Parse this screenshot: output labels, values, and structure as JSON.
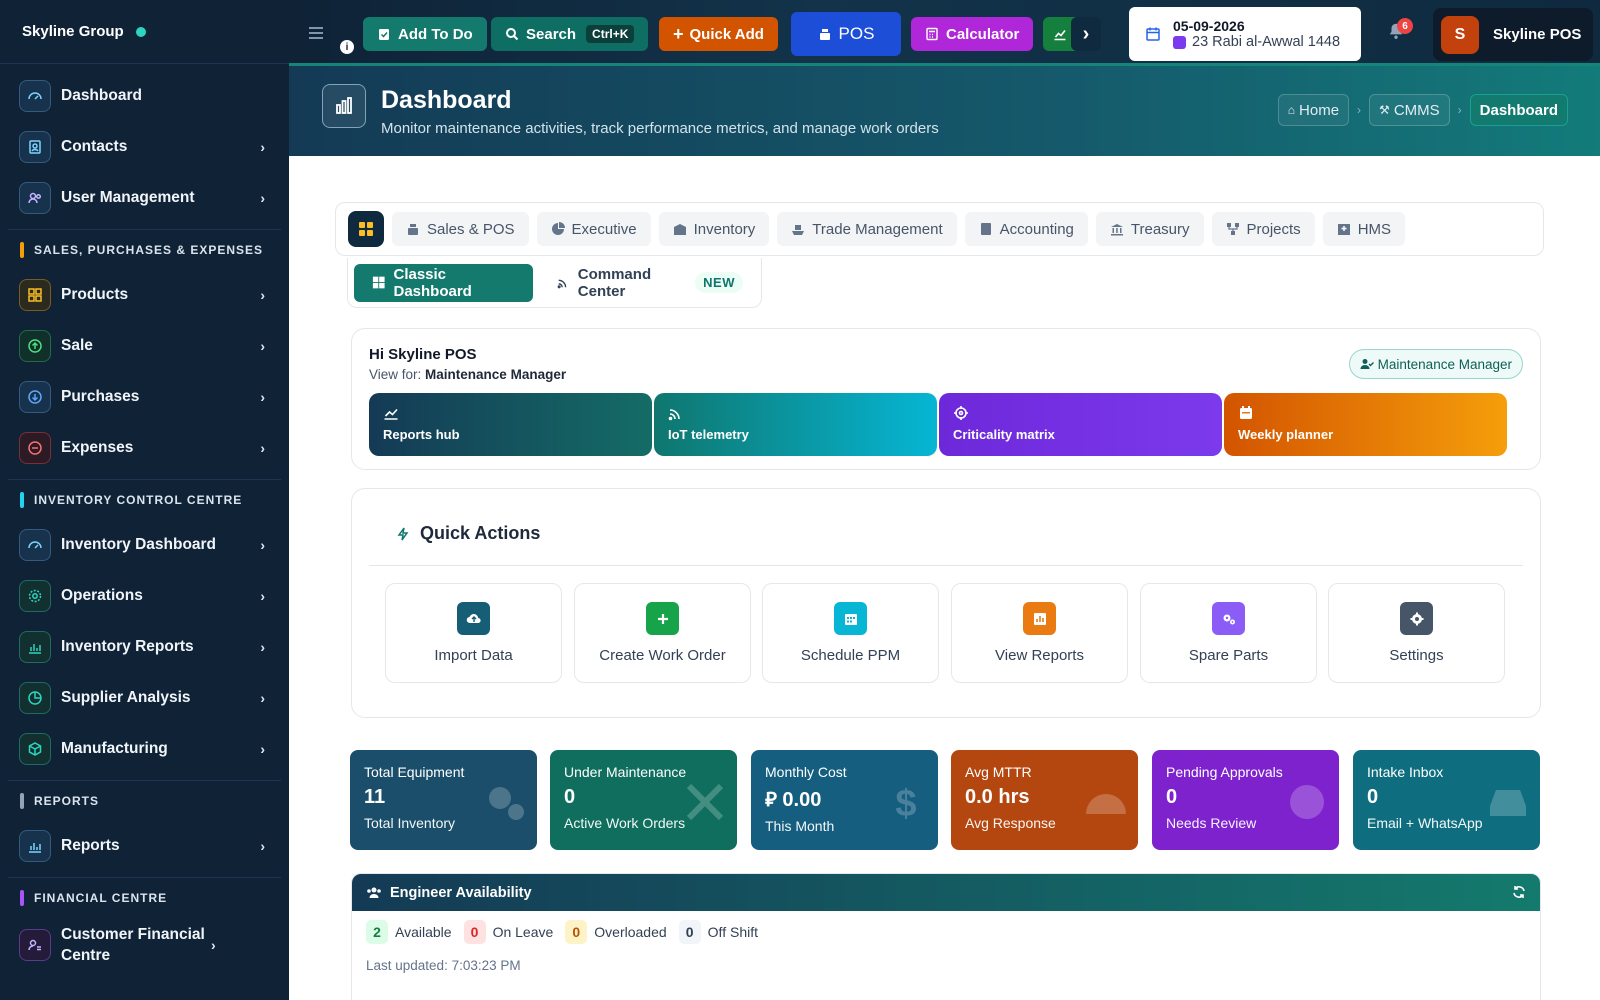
{
  "sidebar": {
    "brand": "Skyline Group",
    "top_items": [
      {
        "label": "Dashboard"
      },
      {
        "label": "Contacts"
      },
      {
        "label": "User Management"
      }
    ],
    "sections": [
      {
        "title": "SALES, PURCHASES & EXPENSES",
        "color": "#f59e0b",
        "items": [
          {
            "label": "Products"
          },
          {
            "label": "Sale"
          },
          {
            "label": "Purchases"
          },
          {
            "label": "Expenses"
          }
        ]
      },
      {
        "title": "INVENTORY CONTROL CENTRE",
        "color": "#22d3ee",
        "items": [
          {
            "label": "Inventory Dashboard"
          },
          {
            "label": "Operations"
          },
          {
            "label": "Inventory Reports"
          },
          {
            "label": "Supplier Analysis"
          },
          {
            "label": "Manufacturing"
          }
        ]
      },
      {
        "title": "REPORTS",
        "color": "#94a3b8",
        "items": [
          {
            "label": "Reports"
          }
        ]
      },
      {
        "title": "FINANCIAL CENTRE",
        "color": "#a855f7",
        "items": [
          {
            "label": "Customer Financial Centre"
          }
        ]
      }
    ]
  },
  "topbar": {
    "add_todo": "Add To Do",
    "search": "Search",
    "search_shortcut": "Ctrl+K",
    "quick_add": "Quick Add",
    "pos": "POS",
    "calculator": "Calculator",
    "date": "05-09-2026",
    "hijri_date": "23 Rabi al-Awwal 1448",
    "notification_count": "6",
    "avatar_initial": "S",
    "profile_name": "Skyline POS"
  },
  "header": {
    "title": "Dashboard",
    "subtitle": "Monitor maintenance activities, track performance metrics, and manage work orders",
    "breadcrumbs": [
      "Home",
      "CMMS",
      "Dashboard"
    ]
  },
  "module_tabs": [
    "Sales & POS",
    "Executive",
    "Inventory",
    "Trade Management",
    "Accounting",
    "Treasury",
    "Projects",
    "HMS"
  ],
  "view_tabs": {
    "classic": "Classic Dashboard",
    "command": "Command Center",
    "new_badge": "NEW"
  },
  "greeting": {
    "title": "Hi Skyline POS",
    "view_for_label": "View for:",
    "view_for_value": "Maintenance Manager",
    "role": "Maintenance Manager",
    "shortcuts": [
      "Reports hub",
      "IoT telemetry",
      "Criticality matrix",
      "Weekly planner"
    ]
  },
  "quick_actions": {
    "title": "Quick Actions",
    "items": [
      "Import Data",
      "Create Work Order",
      "Schedule PPM",
      "View Reports",
      "Spare Parts",
      "Settings"
    ]
  },
  "stats": [
    {
      "title": "Total Equipment",
      "value": "11",
      "sub": "Total Inventory",
      "color": "#155e75"
    },
    {
      "title": "Under Maintenance",
      "value": "0",
      "sub": "Active Work Orders",
      "color": "#0f766e"
    },
    {
      "title": "Monthly Cost",
      "value": "⃁ 0.00",
      "sub": "This Month",
      "color": "#0e5f7d"
    },
    {
      "title": "Avg MTTR",
      "value": "0.0 hrs",
      "sub": "Avg Response",
      "color": "#c2410c"
    },
    {
      "title": "Pending Approvals",
      "value": "0",
      "sub": "Needs Review",
      "color": "#7e22ce"
    },
    {
      "title": "Intake Inbox",
      "value": "0",
      "sub": "Email + WhatsApp",
      "color": "#0e6e80"
    }
  ],
  "engineers": {
    "title": "Engineer Availability",
    "available_count": "2",
    "available_label": "Available",
    "leave_count": "0",
    "leave_label": "On Leave",
    "overloaded_count": "0",
    "overloaded_label": "Overloaded",
    "offshift_count": "0",
    "offshift_label": "Off Shift",
    "last_updated": "Last updated: 7:03:23 PM"
  }
}
